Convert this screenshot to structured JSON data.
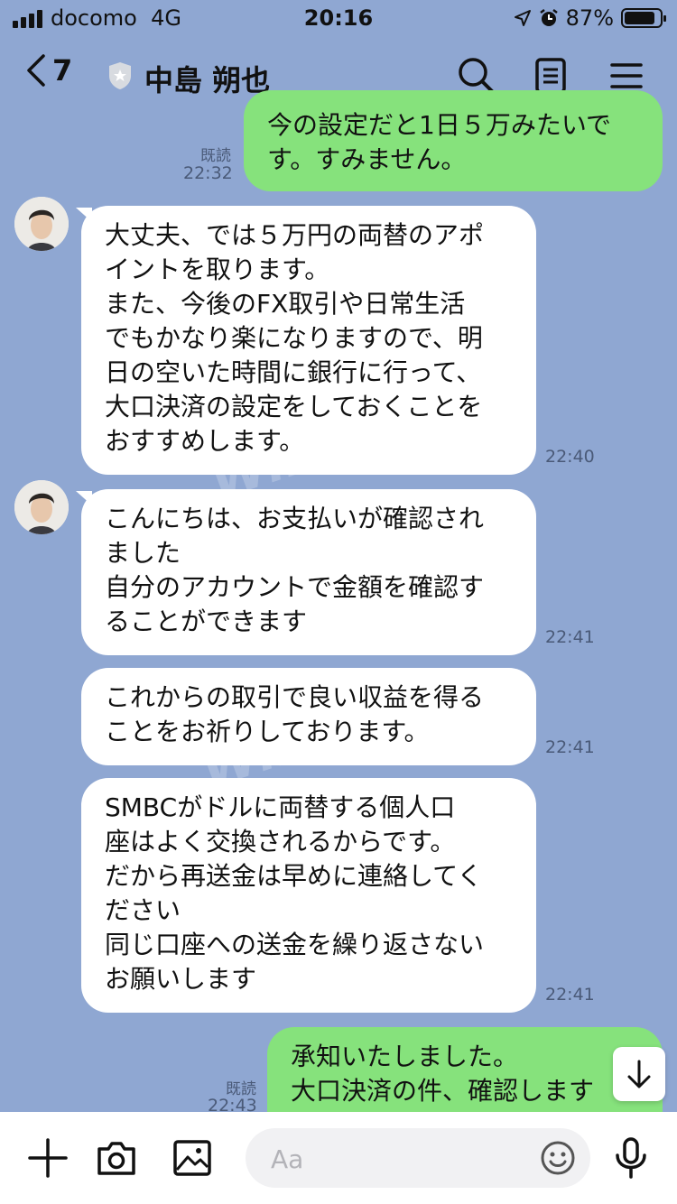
{
  "status_bar": {
    "carrier": "docomo",
    "network": "4G",
    "time": "20:16",
    "battery_pct": "87%",
    "battery_level": 0.87
  },
  "header": {
    "back_count": "7",
    "contact_name": "中島 朔也",
    "background_color": "#8fa7d2"
  },
  "messages": [
    {
      "direction": "out",
      "lines": [
        "今の設定だと1日５万みたいで",
        "す。すみません。"
      ],
      "read_label": "既読",
      "time": "22:32"
    },
    {
      "direction": "in",
      "lines": [
        "大丈夫、では５万円の両替のアポ",
        "イントを取ります。",
        "また、今後のFX取引や日常生活",
        "でもかなり楽になりますので、明",
        "日の空いた時間に銀行に行って、",
        "大口決済の設定をしておくことを",
        "おすすめします。"
      ],
      "time": "22:40"
    },
    {
      "direction": "in",
      "lines": [
        "こんにちは、お支払いが確認され",
        "ました",
        "自分のアカウントで金額を確認す",
        "ることができます"
      ],
      "time": "22:41"
    },
    {
      "direction": "in",
      "lines": [
        "これからの取引で良い収益を得る",
        "ことをお祈りしております。"
      ],
      "time": "22:41"
    },
    {
      "direction": "in",
      "lines": [
        "SMBCがドルに両替する個人口",
        "座はよく交換されるからです。",
        "だから再送金は早めに連絡してく",
        "ださい",
        "同じ口座への送金を繰り返さない",
        "お願いします"
      ],
      "time": "22:41"
    },
    {
      "direction": "out",
      "lines": [
        "承知いたしました。",
        "大口決済の件、確認します"
      ],
      "read_label": "既読",
      "time": "22:43"
    }
  ],
  "watermark": "WikiFX",
  "input": {
    "placeholder": "Aa"
  },
  "icons": {
    "back": "chevron-left-icon",
    "badge": "star-shield-icon",
    "search": "search-icon",
    "notes": "note-icon",
    "menu": "menu-icon",
    "scroll": "arrow-down-icon",
    "plus": "plus-icon",
    "camera": "camera-icon",
    "image": "image-icon",
    "emoji": "emoji-icon",
    "mic": "microphone-icon"
  },
  "colors": {
    "outgoing_bubble": "#86e27c",
    "incoming_bubble": "#ffffff",
    "timestamp": "#4a5a78"
  }
}
